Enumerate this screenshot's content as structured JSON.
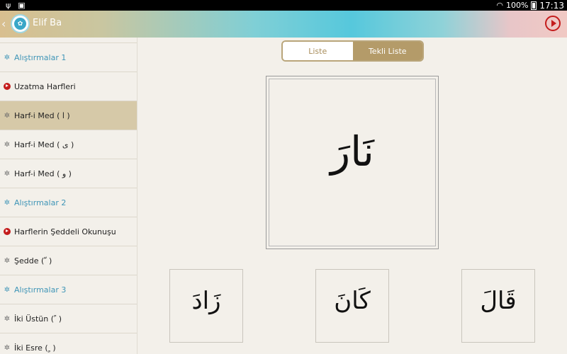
{
  "status": {
    "battery": "100%",
    "time": "17:13"
  },
  "app": {
    "title": "Elif Ba",
    "back": "‹"
  },
  "sidebar": {
    "items": [
      {
        "label": "Alıştırmalar 1",
        "kind": "section",
        "icon": "gear-icon"
      },
      {
        "label": "Uzatma Harfleri",
        "kind": "lesson",
        "icon": "play-icon"
      },
      {
        "label": "Harf-i Med ( ا )",
        "kind": "item",
        "icon": "gear-icon",
        "selected": true
      },
      {
        "label": "Harf-i Med ( ى )",
        "kind": "item",
        "icon": "gear-icon"
      },
      {
        "label": "Harf-i Med ( و )",
        "kind": "item",
        "icon": "gear-icon"
      },
      {
        "label": "Alıştırmalar 2",
        "kind": "section",
        "icon": "gear-icon"
      },
      {
        "label": "Harflerin Şeddeli Okunuşu",
        "kind": "lesson",
        "icon": "play-icon"
      },
      {
        "label": "Şedde ( ّ )",
        "kind": "item",
        "icon": "gear-icon"
      },
      {
        "label": "Alıştırmalar 3",
        "kind": "section",
        "icon": "gear-icon"
      },
      {
        "label": "İki Üstün ( ً )",
        "kind": "item",
        "icon": "gear-icon"
      },
      {
        "label": "İki Esre ( ٍ )",
        "kind": "item",
        "icon": "gear-icon"
      }
    ]
  },
  "tabs": {
    "liste": "Liste",
    "tekli": "Tekli Liste",
    "active": "tekli"
  },
  "main_word": "نَارَ",
  "choices": [
    "زَادَ",
    "كَانَ",
    "قَالَ"
  ],
  "colors": {
    "accent_gold": "#b49b69",
    "section_blue": "#3f95b7",
    "play_red": "#c41c1c",
    "selected_bg": "#d6c9a8"
  }
}
